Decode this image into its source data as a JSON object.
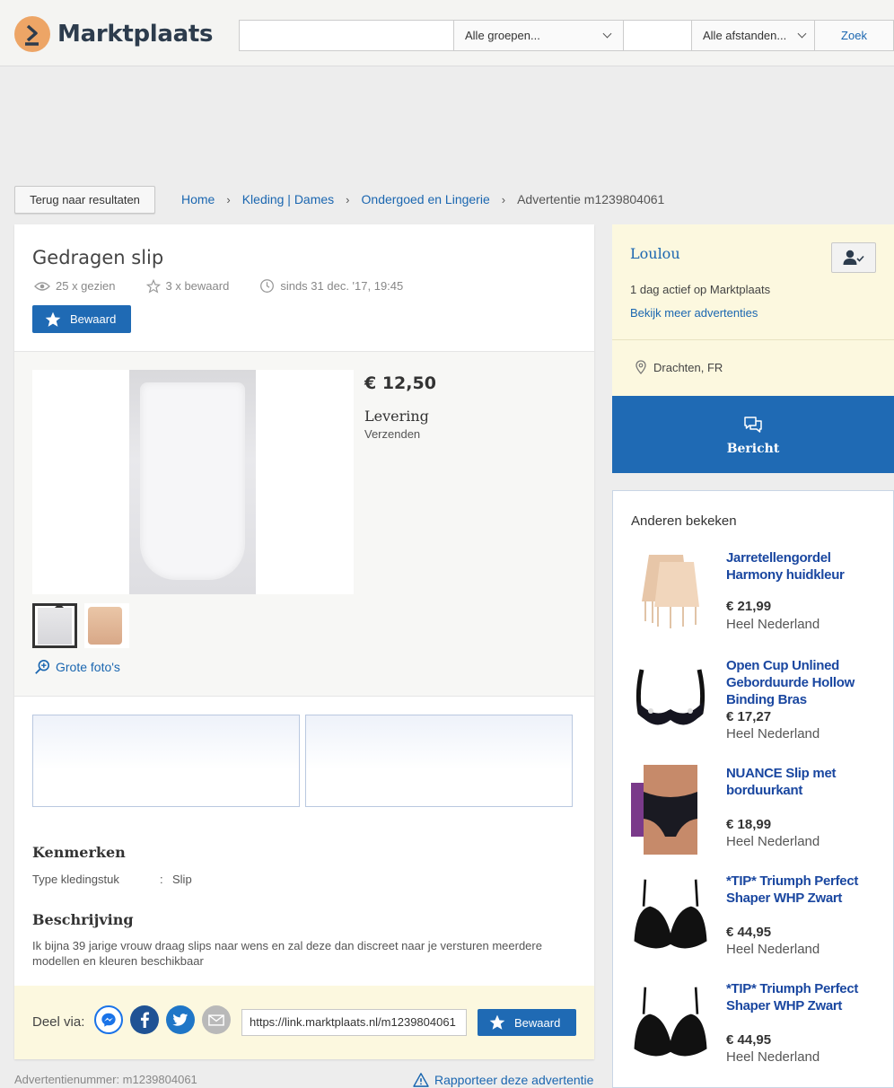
{
  "header": {
    "logo_text": "Marktplaats",
    "search_value": "",
    "group_select": "Alle groepen...",
    "zip_value": "",
    "distance_select": "Alle afstanden...",
    "search_button": "Zoek"
  },
  "nav": {
    "back_button": "Terug naar resultaten",
    "breadcrumbs": [
      "Home",
      "Kleding | Dames",
      "Ondergoed en Lingerie"
    ],
    "current": "Advertentie m1239804061"
  },
  "listing": {
    "title": "Gedragen slip",
    "views": "25 x gezien",
    "saves": "3 x bewaard",
    "since": "sinds 31 dec. '17, 19:45",
    "save_button": "Bewaard",
    "price": "€ 12,50",
    "delivery_label": "Levering",
    "delivery_value": "Verzenden",
    "photo_count": 2,
    "zoom_link": "Grote foto's",
    "features_heading": "Kenmerken",
    "features": [
      {
        "key": "Type kledingstuk",
        "value": "Slip"
      }
    ],
    "description_heading": "Beschrijving",
    "description": "Ik bijna 39 jarige vrouw draag slips naar wens en zal deze dan discreet naar je versturen meerdere modellen en kleuren beschikbaar"
  },
  "share": {
    "label": "Deel via:",
    "icons": [
      "messenger-icon",
      "facebook-icon",
      "twitter-icon",
      "mail-icon"
    ],
    "link": "https://link.marktplaats.nl/m1239804061",
    "save_button": "Bewaard"
  },
  "footer": {
    "ad_number": "Advertentienummer: m1239804061",
    "report": "Rapporteer deze advertentie"
  },
  "seller": {
    "name": "Loulou",
    "active": "1 dag actief op Marktplaats",
    "more_link": "Bekijk meer advertenties",
    "location": "Drachten, FR",
    "message_button": "Bericht"
  },
  "others": {
    "title": "Anderen bekeken",
    "items": [
      {
        "title": "Jarretellengordel Harmony huidkleur",
        "price": "€ 21,99",
        "location": "Heel Nederland"
      },
      {
        "title": "Open Cup Unlined Geborduurde Hollow Binding Bras",
        "price": "€ 17,27",
        "location": "Heel Nederland"
      },
      {
        "title": "NUANCE Slip met borduurkant",
        "price": "€ 18,99",
        "location": "Heel Nederland"
      },
      {
        "title": "*TIP* Triumph Perfect Shaper WHP Zwart",
        "price": "€ 44,95",
        "location": "Heel Nederland"
      },
      {
        "title": "*TIP* Triumph Perfect Shaper WHP Zwart",
        "price": "€ 44,95",
        "location": "Heel Nederland"
      }
    ]
  },
  "colors": {
    "brand_blue": "#1f6ab4",
    "link_blue": "#1a66b0",
    "logo_orange": "#eda566",
    "seller_bg": "#fcf8df"
  }
}
